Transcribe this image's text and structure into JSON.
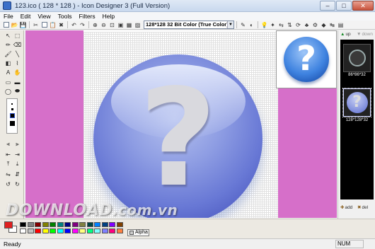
{
  "window": {
    "title": "123.ico  ( 128 * 128 ) - Icon Designer 3 (Full Version)",
    "minimize": "–",
    "maximize": "□",
    "close": "✕"
  },
  "menu": [
    "File",
    "Edit",
    "View",
    "Tools",
    "Filters",
    "Help"
  ],
  "toolbar": {
    "format_select": "128*128  32 Bit Color (True Color)",
    "icons": [
      "new-icon",
      "open-icon",
      "save-icon",
      "cut-icon",
      "copy-icon",
      "paste-icon",
      "delete-icon",
      "undo-icon",
      "redo-icon",
      "zoom-in-icon",
      "zoom-out-icon",
      "fit-icon",
      "actual-size-icon",
      "grid-icon",
      "image-icon"
    ],
    "right_icons": [
      "tool-a-icon",
      "tool-b-icon",
      "bulb-icon",
      "effect-icon",
      "flip-h-icon",
      "flip-v-icon",
      "rotate-icon",
      "tree-icon",
      "gear-icon",
      "color-icon",
      "shift-icon",
      "fill-icon"
    ]
  },
  "tools": [
    "select",
    "rect-select",
    "pencil",
    "eraser",
    "brush",
    "line",
    "fill",
    "picker",
    "text",
    "hand",
    "rect",
    "filled-rect",
    "ellipse",
    "filled-ellipse"
  ],
  "canvas": {
    "glyph": "?"
  },
  "preview": {
    "glyph": "?"
  },
  "icon_list": {
    "up_label": "up",
    "down_label": "down",
    "items": [
      {
        "caption": "86*86*32"
      },
      {
        "caption": "128*128*32"
      }
    ],
    "add_label": "add",
    "del_label": "del"
  },
  "palette": {
    "colors": [
      "#000000",
      "#808080",
      "#800000",
      "#808000",
      "#008000",
      "#008080",
      "#000080",
      "#800080",
      "#808040",
      "#004040",
      "#0080ff",
      "#004080",
      "#8000ff",
      "#804000",
      "#ffffff",
      "#c0c0c0",
      "#ff0000",
      "#ffff00",
      "#00ff00",
      "#00ffff",
      "#0000ff",
      "#ff00ff",
      "#ffff80",
      "#00ff80",
      "#80ffff",
      "#8080ff",
      "#ff0080",
      "#ff8040"
    ],
    "alpha_label": "Alpha"
  },
  "watermark": {
    "text": "DOWNLOAD",
    "domain": ".com.vn"
  },
  "status": {
    "left": "Ready",
    "num": "NUM"
  }
}
